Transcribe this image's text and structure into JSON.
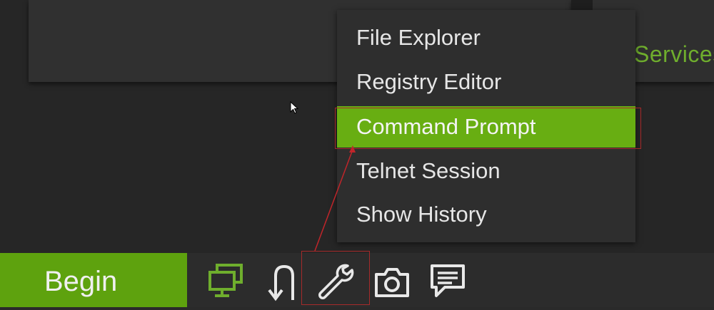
{
  "header": {
    "services_label": "Services"
  },
  "context_menu": {
    "items": [
      {
        "label": "File Explorer",
        "highlighted": false
      },
      {
        "label": "Registry Editor",
        "highlighted": false
      },
      {
        "label": "Command Prompt",
        "highlighted": true
      },
      {
        "label": "Telnet Session",
        "highlighted": false
      },
      {
        "label": "Show History",
        "highlighted": false
      }
    ]
  },
  "taskbar": {
    "begin_label": "Begin",
    "icons": [
      "monitors-icon",
      "u-turn-arrow-icon",
      "wrench-icon",
      "camera-icon",
      "chat-icon"
    ]
  },
  "colors": {
    "accent_green": "#68ae12",
    "services_green": "#6fae2d",
    "annotation_red": "#a52a2a"
  }
}
